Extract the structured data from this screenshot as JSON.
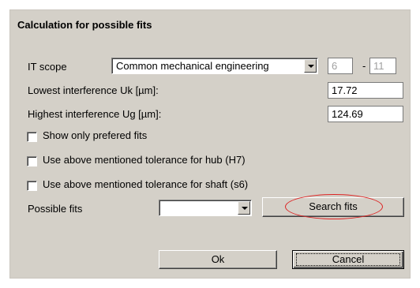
{
  "dialog": {
    "title": "Calculation for possible fits",
    "it_scope": {
      "label": "IT scope",
      "selected": "Common mechanical engineering",
      "from": "6",
      "separator": "-",
      "to": "11"
    },
    "lowest_interference": {
      "label": "Lowest interference Uk [µm]:",
      "value": "17.72"
    },
    "highest_interference": {
      "label": "Highest interference Ug [µm]:",
      "value": "124.69"
    },
    "checkboxes": [
      {
        "label": "Show only prefered fits",
        "checked": false
      },
      {
        "label": "Use above mentioned tolerance for hub (H7)",
        "checked": false
      },
      {
        "label": "Use above mentioned tolerance for shaft (s6)",
        "checked": false
      }
    ],
    "possible_fits": {
      "label": "Possible fits",
      "selected": ""
    },
    "search_button": "Search fits",
    "ok_button": "Ok",
    "cancel_button": "Cancel"
  },
  "colors": {
    "dialog_bg": "#d4d0c8",
    "annotation": "#dd2222"
  }
}
